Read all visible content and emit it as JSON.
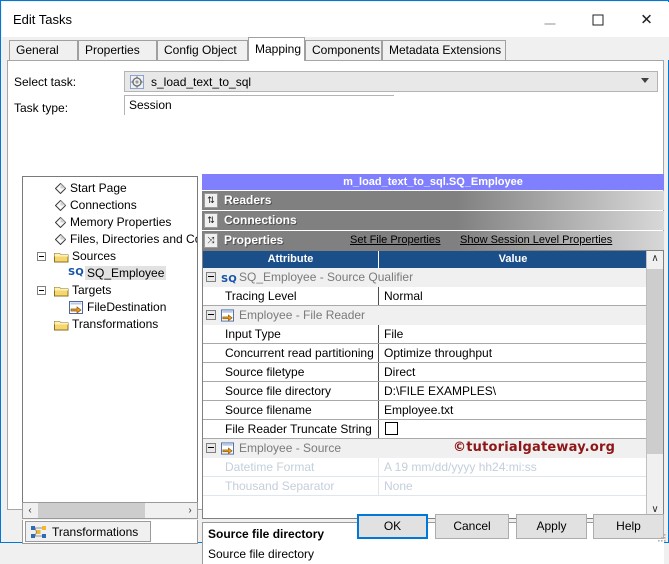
{
  "window": {
    "title": "Edit Tasks",
    "controls": {
      "minimize": "–",
      "maximize": "□",
      "close": "✕"
    }
  },
  "tabs": [
    {
      "label": "General",
      "selected": false
    },
    {
      "label": "Properties",
      "selected": false
    },
    {
      "label": "Config Object",
      "selected": false
    },
    {
      "label": "Mapping",
      "selected": true
    },
    {
      "label": "Components",
      "selected": false
    },
    {
      "label": "Metadata Extensions",
      "selected": false
    }
  ],
  "form": {
    "select_task_label": "Select task:",
    "select_task_value": "s_load_text_to_sql",
    "select_task_icon": "gear-icon",
    "task_type_label": "Task type:",
    "task_type_value": "Session"
  },
  "tree": {
    "items": [
      {
        "label": "Start Page",
        "icon": "diamond-icon",
        "indent": 1,
        "expander": false
      },
      {
        "label": "Connections",
        "icon": "diamond-icon",
        "indent": 1,
        "expander": false
      },
      {
        "label": "Memory Properties",
        "icon": "diamond-icon",
        "indent": 1,
        "expander": false
      },
      {
        "label": "Files, Directories and Com",
        "icon": "diamond-icon",
        "indent": 1,
        "expander": false
      },
      {
        "label": "Sources",
        "icon": "folder-icon",
        "indent": 1,
        "expander": true
      },
      {
        "label": "SQ_Employee",
        "icon": "sq-icon",
        "indent": 2,
        "expander": false,
        "selected": true
      },
      {
        "label": "Targets",
        "icon": "folder-icon",
        "indent": 1,
        "expander": true
      },
      {
        "label": "FileDestination",
        "icon": "target-arrow-icon",
        "indent": 2,
        "expander": false
      },
      {
        "label": "Transformations",
        "icon": "folder-icon",
        "indent": 1,
        "expander": false
      }
    ],
    "hscroll": {
      "left_arrow": "‹",
      "right_arrow": "›"
    },
    "bottom_tab": {
      "label": "Transformations",
      "icon": "transformations-icon"
    }
  },
  "right": {
    "title": "m_load_text_to_sql.SQ_Employee",
    "sections": [
      {
        "name": "Readers",
        "toggle": "↕"
      },
      {
        "name": "Connections",
        "toggle": "↕"
      },
      {
        "name": "Properties",
        "toggle": "↕"
      }
    ],
    "links": [
      {
        "label": "Set File Properties"
      },
      {
        "label": "Show Session Level Properties"
      }
    ],
    "table": {
      "headers": {
        "attribute": "Attribute",
        "value": "Value"
      },
      "rows": [
        {
          "kind": "group",
          "label": "SQ_Employee - Source Qualifier",
          "icon": "sq-icon"
        },
        {
          "kind": "row",
          "attribute": "Tracing Level",
          "value": "Normal"
        },
        {
          "kind": "group",
          "label": "Employee - File Reader",
          "icon": "reader-arrow-icon"
        },
        {
          "kind": "row",
          "attribute": "Input Type",
          "value": "File"
        },
        {
          "kind": "row",
          "attribute": "Concurrent read partitioning",
          "value": "Optimize throughput"
        },
        {
          "kind": "row",
          "attribute": "Source filetype",
          "value": "Direct"
        },
        {
          "kind": "row",
          "attribute": "Source file directory",
          "value": "D:\\FILE EXAMPLES\\"
        },
        {
          "kind": "row",
          "attribute": "Source filename",
          "value": "Employee.txt"
        },
        {
          "kind": "row",
          "attribute": "File Reader Truncate String Null",
          "value": "",
          "checkbox": true,
          "checked": false
        },
        {
          "kind": "group",
          "label": "Employee - Source",
          "icon": "reader-arrow-icon",
          "watermark": "©tutorialgateway.org"
        },
        {
          "kind": "row",
          "attribute": "Datetime Format",
          "value": "A  19 mm/dd/yyyy hh24:mi:ss",
          "disabled": true
        },
        {
          "kind": "row",
          "attribute": "Thousand Separator",
          "value": "None",
          "disabled": true
        }
      ]
    },
    "scrollbar": {
      "up": "∧",
      "down": "∨"
    }
  },
  "description": {
    "title": "Source file directory",
    "text": "Source file directory"
  },
  "buttons": [
    {
      "label": "OK",
      "default": true
    },
    {
      "label": "Cancel",
      "default": false
    },
    {
      "label": "Apply",
      "default": false
    },
    {
      "label": "Help",
      "default": false
    }
  ],
  "colors": {
    "accent": "#0078d7",
    "panel_title": "#8080ff",
    "table_header": "#1b4f8a",
    "watermark": "#8e1616"
  }
}
